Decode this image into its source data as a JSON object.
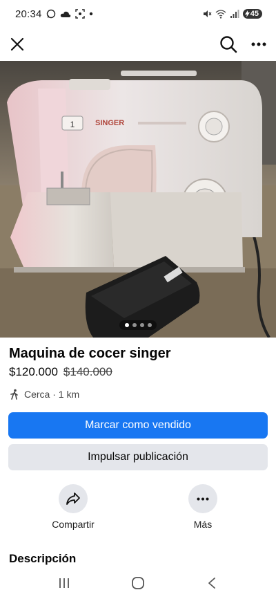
{
  "status_bar": {
    "time": "20:34",
    "battery": "45",
    "icons": [
      "whatsapp-icon",
      "cloud-icon",
      "screenshot-icon",
      "dot-icon",
      "mute-icon",
      "wifi-icon",
      "signal-icon",
      "battery-charging-icon"
    ]
  },
  "header": {
    "close_icon": "close-icon",
    "search_icon": "search-icon",
    "more_icon": "more-horizontal-icon"
  },
  "photo": {
    "brand_text": "SINGER",
    "pedal_label": "SINGER",
    "carousel": {
      "count": 4,
      "active_index": 0
    }
  },
  "listing": {
    "title": "Maquina de cocer singer",
    "price": "$120.000",
    "old_price": "$140.000",
    "location": "Cerca · 1 km"
  },
  "buttons": {
    "mark_sold": "Marcar como vendido",
    "boost": "Impulsar publicación"
  },
  "actions": {
    "share": "Compartir",
    "more": "Más"
  },
  "description": {
    "heading": "Descripción"
  },
  "colors": {
    "primary": "#1877f2",
    "secondary_bg": "#e4e6eb"
  },
  "nav_bar": {
    "icons": [
      "recents-icon",
      "home-icon",
      "back-icon"
    ]
  }
}
